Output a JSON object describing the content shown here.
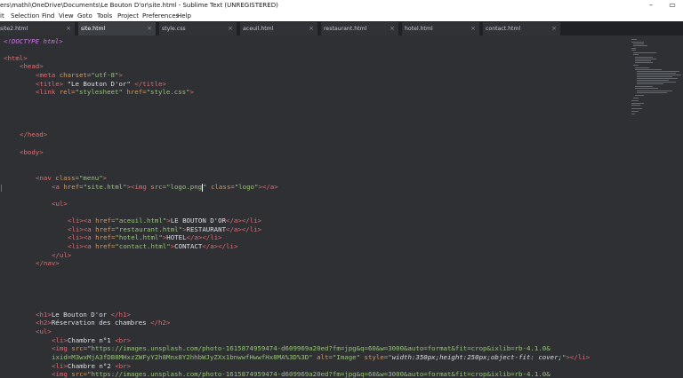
{
  "window": {
    "title": "ers\\mathi\\OneDrive\\Documents\\Le Bouton D'or\\site.html - Sublime Text (UNREGISTERED)",
    "minimize_glyph": "–",
    "maximize_glyph": "▭"
  },
  "menubar": {
    "items": [
      "it",
      "Selection",
      "Find",
      "View",
      "Goto",
      "Tools",
      "Project",
      "Preferences",
      "Help"
    ]
  },
  "tabs": [
    {
      "label": "site2.html",
      "active": false
    },
    {
      "label": "site.html",
      "active": true
    },
    {
      "label": "style.css",
      "active": false
    },
    {
      "label": "aceuil.html",
      "active": false
    },
    {
      "label": "restaurant.html",
      "active": false
    },
    {
      "label": "hotel.html",
      "active": false
    },
    {
      "label": "contact.html",
      "active": false
    }
  ],
  "tab_close_glyph": "×",
  "colors": {
    "tag": "#e06c75",
    "attribute": "#d19a66",
    "string": "#98c379",
    "text": "#dcdfe4",
    "doctype": "#c678dd",
    "editor_bg": "#2e3033"
  },
  "code": {
    "doctype": "<!DOCTYPE html>",
    "html_open": "<html>",
    "head_open": "<head>",
    "meta": {
      "tag": "<meta",
      "attr": " charset=",
      "value": "\"utf-8\"",
      "close": ">"
    },
    "title": {
      "open": "<title>",
      "text": " \"Le Bouton D'or\" ",
      "close": "</title>"
    },
    "link": {
      "tag": "<link",
      "attr1": " rel=",
      "val1": "\"stylesheet\"",
      "attr2": " href=",
      "val2": "\"style.css\"",
      "close": ">"
    },
    "head_close": "</head>",
    "body_open": "<body>",
    "nav": {
      "tag": "<nav",
      "attr": " class=",
      "value": "\"menu\"",
      "close": ">"
    },
    "logo_link": {
      "a_open": "<a",
      "href_attr": " href=",
      "href_val": "\"site.html\"",
      "gt": ">",
      "img_open": "<img",
      "src_attr": " src=",
      "src_val_a": "\"logo.png",
      "src_val_b": "\"",
      "class_attr": " class=",
      "class_val": "\"logo\"",
      "end": "></a>"
    },
    "ul_open": "<ul>",
    "nav_items": [
      {
        "href": "\"aceuil.html\"",
        "text": "LE BOUTON D'OR"
      },
      {
        "href": "\"restaurant.html\"",
        "text": "RESTAURANT"
      },
      {
        "href": "\"hotel.html\"",
        "text": "HOTEL"
      },
      {
        "href": "\"contact.html\"",
        "text": "CONTACT"
      }
    ],
    "li_open": "<li>",
    "a_open": "<a",
    "href_attr": " href=",
    "gt": ">",
    "a_close": "</a>",
    "li_close": "</li>",
    "ul_close": "</ul>",
    "nav_close": "</nav>",
    "h1": {
      "open": "<h1>",
      "text": "Le Bouton D'or ",
      "close": "</h1>"
    },
    "h2": {
      "open": "<h2>",
      "text": "Réservation des chambres ",
      "close": "</h2>"
    },
    "ul2_open": "<ul>",
    "room1": {
      "open": "<li>",
      "text": "Chambre n°1 ",
      "br": "<br>"
    },
    "img1": {
      "tag": "<img",
      "src_attr": " src=",
      "src_val": "\"https://images.unsplash.com/photo-1615874959474-d609969a20ed?fm=jpg&q=60&w=3000&auto=format&fit=crop&ixlib=rb-4.1.0&",
      "src_val_cont": "ixid=M3wxMjA3fDB8MHxzZWFyY2h8Mnx8Y2hhbWJyZXx1bnwwfHwwfHx8MA%3D%3D\"",
      "alt_attr": " alt=",
      "alt_val": "\"Image\"",
      "style_attr": " style=",
      "style_val_a": "\"",
      "style_val_b": "width:350px;height:250px;object-fit: cover;",
      "style_val_c": "\"",
      "end": "></li>"
    },
    "room2": {
      "open": "<li>",
      "text": "Chambre n°2 ",
      "br": "<br>"
    },
    "img2": {
      "tag": "<img",
      "src_attr": " src=",
      "src_val": "\"https://images.unsplash.com/photo-1615874959474-d609969a20ed?fm=jpg&q=60&w=3000&auto=format&fit=crop&ixlib=rb-4.1.0&"
    }
  }
}
